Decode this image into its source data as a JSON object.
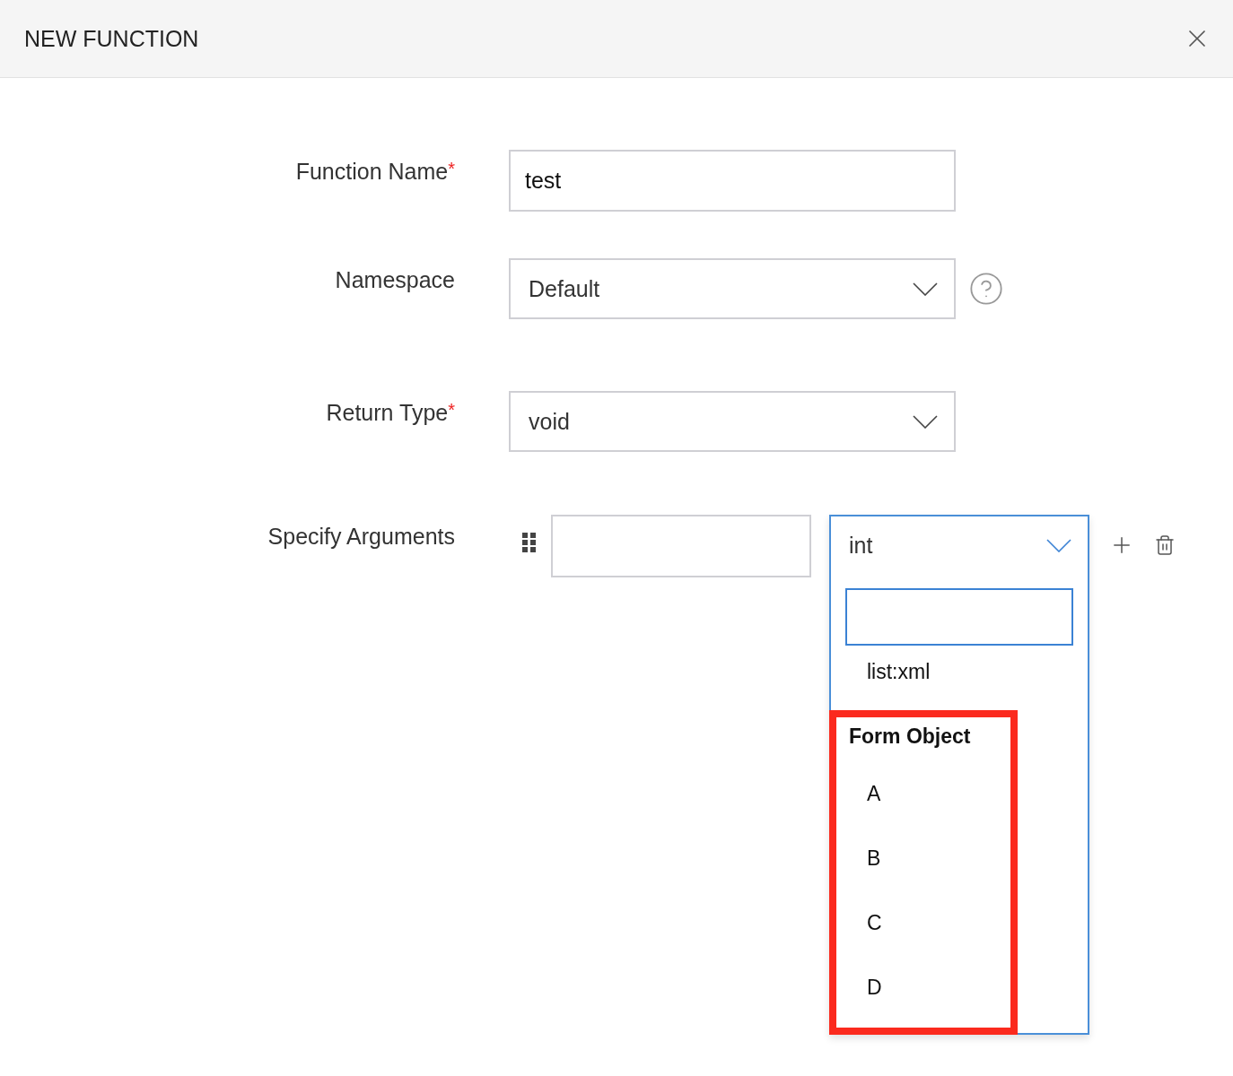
{
  "dialog": {
    "title": "NEW FUNCTION"
  },
  "fields": [
    {
      "kind": "text",
      "label": "Function Name",
      "required_mark": "*",
      "value": "test"
    },
    {
      "kind": "select",
      "label": "Namespace",
      "value": "Default",
      "help": true
    },
    {
      "kind": "select",
      "label": "Return Type",
      "required_mark": "*",
      "value": "void"
    }
  ],
  "arguments": {
    "label": "Specify Arguments",
    "type_dropdown": {
      "value": "int",
      "expanded": true,
      "options": [
        "list:xml"
      ],
      "groups": [
        {
          "label": "Form Object",
          "highlighted": true,
          "items": [
            "A",
            "B",
            "C",
            "D"
          ]
        }
      ]
    }
  }
}
